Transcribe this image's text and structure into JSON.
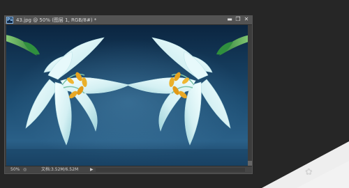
{
  "window": {
    "app_badge": "Ps",
    "title": "43.jpg @ 50% (图层 1, RGB/8#) *",
    "buttons": {
      "minimize": "▬",
      "restore": "❐",
      "close": "✕"
    }
  },
  "status": {
    "zoom": "50%",
    "doc_info": "文档:3.52M/6.52M",
    "menu_arrow": "▶"
  },
  "colors": {
    "canvas_top": "#0b2540",
    "canvas_mid": "#1f5378",
    "petal": "#d8f2f4",
    "stamen": "#e4a51f",
    "stem": "#3fa24b"
  }
}
